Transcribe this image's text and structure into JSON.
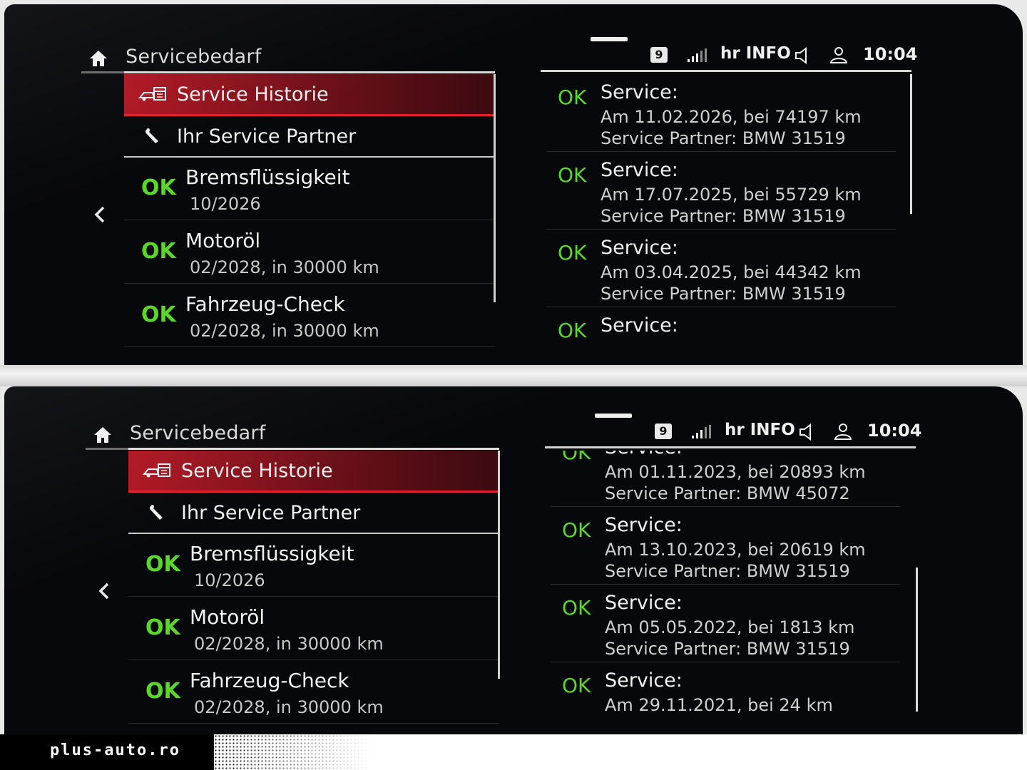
{
  "screens": [
    {
      "title": "Servicebedarf",
      "menu": {
        "history_label": "Service Historie",
        "partner_label": "Ihr Service Partner"
      },
      "services": [
        {
          "status": "OK",
          "name": "Bremsflüssigkeit",
          "detail": "10/2026"
        },
        {
          "status": "OK",
          "name": "Motoröl",
          "detail": "02/2028, in 30000 km"
        },
        {
          "status": "OK",
          "name": "Fahrzeug-Check",
          "detail": "02/2028, in 30000 km"
        }
      ],
      "status_bar": {
        "badge": "9",
        "radio": "hr INFO",
        "clock": "10:04"
      },
      "history": [
        {
          "status": "OK",
          "label": "Service:",
          "line1": "Am 11.02.2026, bei 74197 km",
          "line2": "Service Partner: BMW 31519"
        },
        {
          "status": "OK",
          "label": "Service:",
          "line1": "Am 17.07.2025, bei 55729 km",
          "line2": "Service Partner: BMW 31519"
        },
        {
          "status": "OK",
          "label": "Service:",
          "line1": "Am 03.04.2025, bei 44342 km",
          "line2": "Service Partner: BMW 31519"
        },
        {
          "status": "OK",
          "label": "Service:",
          "line1": "",
          "line2": ""
        }
      ]
    },
    {
      "title": "Servicebedarf",
      "menu": {
        "history_label": "Service Historie",
        "partner_label": "Ihr Service Partner"
      },
      "services": [
        {
          "status": "OK",
          "name": "Bremsflüssigkeit",
          "detail": "10/2026"
        },
        {
          "status": "OK",
          "name": "Motoröl",
          "detail": "02/2028, in 30000 km"
        },
        {
          "status": "OK",
          "name": "Fahrzeug-Check",
          "detail": "02/2028, in 30000 km"
        }
      ],
      "status_bar": {
        "badge": "9",
        "radio": "hr INFO",
        "clock": "10:04"
      },
      "history": [
        {
          "status": "OK",
          "label": "Service:",
          "line1": "Am 01.11.2023, bei 20893 km",
          "line2": "Service Partner: BMW 45072"
        },
        {
          "status": "OK",
          "label": "Service:",
          "line1": "Am 13.10.2023, bei 20619 km",
          "line2": "Service Partner: BMW 31519"
        },
        {
          "status": "OK",
          "label": "Service:",
          "line1": "Am 05.05.2022, bei 1813 km",
          "line2": "Service Partner: BMW 31519"
        },
        {
          "status": "OK",
          "label": "Service:",
          "line1": "Am 29.11.2021, bei 24 km",
          "line2": ""
        }
      ]
    }
  ],
  "watermark": {
    "brand": "plus-auto.ro"
  },
  "icons": [
    "home-icon",
    "car-calendar-icon",
    "wrench-icon",
    "chevron-left-icon",
    "signal-icon",
    "speaker-icon",
    "user-icon"
  ],
  "colors": {
    "ok_green": "#5bd72a",
    "active_red": "#b01622",
    "accent_red": "#e2202d"
  }
}
